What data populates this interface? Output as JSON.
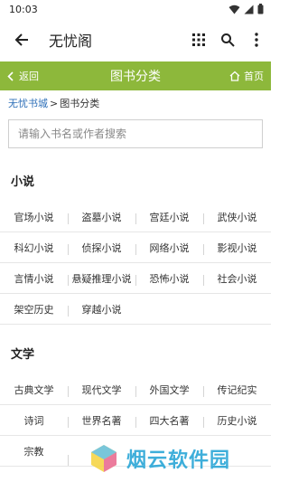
{
  "status_bar": {
    "time": "10:03"
  },
  "app_bar": {
    "title": "无忧阁"
  },
  "green_bar": {
    "back_label": "返回",
    "title": "图书分类",
    "home_label": "首页"
  },
  "breadcrumb": {
    "home": "无忧书城",
    "separator": ">",
    "current": "图书分类"
  },
  "search": {
    "placeholder": "请输入书名或作者搜索"
  },
  "sections": [
    {
      "title": "小说",
      "rows": [
        [
          "官场小说",
          "盗墓小说",
          "宫廷小说",
          "武侠小说"
        ],
        [
          "科幻小说",
          "侦探小说",
          "网络小说",
          "影视小说"
        ],
        [
          "言情小说",
          "悬疑推理小说",
          "恐怖小说",
          "社会小说"
        ],
        [
          "架空历史",
          "穿越小说",
          "",
          ""
        ]
      ]
    },
    {
      "title": "文学",
      "rows": [
        [
          "古典文学",
          "现代文学",
          "外国文学",
          "传记纪实"
        ],
        [
          "诗词",
          "世界名著",
          "四大名著",
          "历史小说"
        ],
        [
          "宗教",
          "",
          "",
          ""
        ]
      ]
    }
  ],
  "watermark": {
    "text": "烟云软件园"
  },
  "colors": {
    "accent_green": "#8db83b",
    "link_blue": "#2d6fb8"
  }
}
